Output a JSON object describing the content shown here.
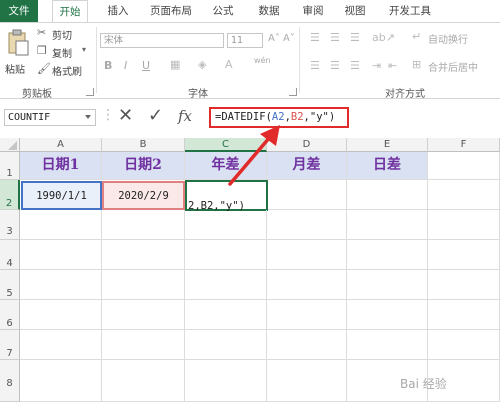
{
  "tabs": [
    {
      "label": "文件"
    },
    {
      "label": "开始"
    },
    {
      "label": "插入"
    },
    {
      "label": "页面布局"
    },
    {
      "label": "公式"
    },
    {
      "label": "数据"
    },
    {
      "label": "审阅"
    },
    {
      "label": "视图"
    },
    {
      "label": "开发工具"
    }
  ],
  "ribbon": {
    "clipboard": {
      "paste": "粘贴",
      "cut": "剪切",
      "copy": "复制",
      "format_painter": "格式刷",
      "group": "剪贴板"
    },
    "font": {
      "font_name": "宋体",
      "font_size": "11",
      "bold": "B",
      "italic": "I",
      "underline": "U",
      "phonetic": "wén",
      "group": "字体"
    },
    "alignment": {
      "wrap_text": "自动换行",
      "merge_center": "合并后居中",
      "group": "对齐方式"
    }
  },
  "formula_bar": {
    "name_box": "COUNTIF",
    "cancel": "✕",
    "enter": "✓",
    "fx": "fx",
    "formula_prefix": "=DATEDIF(",
    "ref_a": "A2",
    "comma1": ",",
    "ref_b": "B2",
    "formula_suffix": ",\"y\")"
  },
  "columns": [
    "A",
    "B",
    "C",
    "D",
    "E",
    "F"
  ],
  "rows": [
    "1",
    "2",
    "3",
    "4",
    "5",
    "6",
    "7",
    "8"
  ],
  "cells": {
    "A1": "日期1",
    "B1": "日期2",
    "C1": "年差",
    "D1": "月差",
    "E1": "日差",
    "A2": "1990/1/1",
    "B2": "2020/2/9",
    "C2": "2,B2,\"y\")"
  },
  "colors": {
    "accent": "#217346",
    "header_fill": "#d9e1f2",
    "header_text": "#7030a0",
    "highlight_red": "#e12a2a",
    "ref_a": "#4472c4",
    "ref_b": "#d9534f"
  },
  "watermark": "Bai 经验"
}
